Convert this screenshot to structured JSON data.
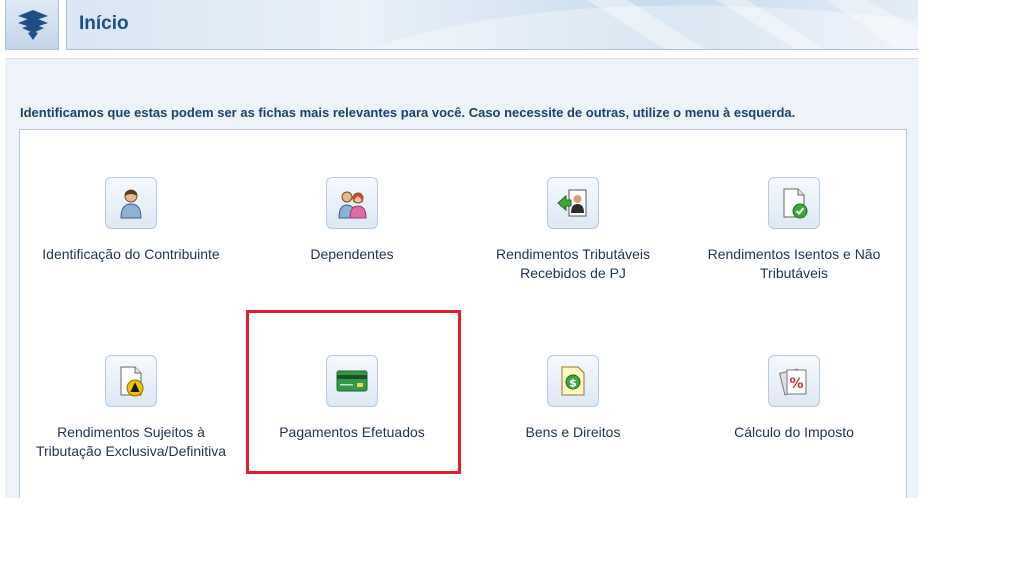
{
  "header": {
    "title": "Início"
  },
  "intro_text": "Identificamos que estas podem ser as fichas mais relevantes para você. Caso necessite de outras, utilize o menu à esquerda.",
  "cards": [
    {
      "label": "Identificação do Contribuinte",
      "icon": "person-icon"
    },
    {
      "label": "Dependentes",
      "icon": "dependents-icon"
    },
    {
      "label": "Rendimentos Tributáveis Recebidos de PJ",
      "icon": "income-pj-icon"
    },
    {
      "label": "Rendimentos Isentos e Não Tributáveis",
      "icon": "exempt-income-icon"
    },
    {
      "label": "Rendimentos Sujeitos à Tributação Exclusiva/Definitiva",
      "icon": "exclusive-tax-icon"
    },
    {
      "label": "Pagamentos Efetuados",
      "icon": "credit-card-icon"
    },
    {
      "label": "Bens e Direitos",
      "icon": "assets-icon"
    },
    {
      "label": "Cálculo do Imposto",
      "icon": "tax-calculation-icon"
    }
  ],
  "colors": {
    "title": "#1d4d86",
    "highlight": "#e41e2b",
    "content_bg": "#eef3f9"
  }
}
